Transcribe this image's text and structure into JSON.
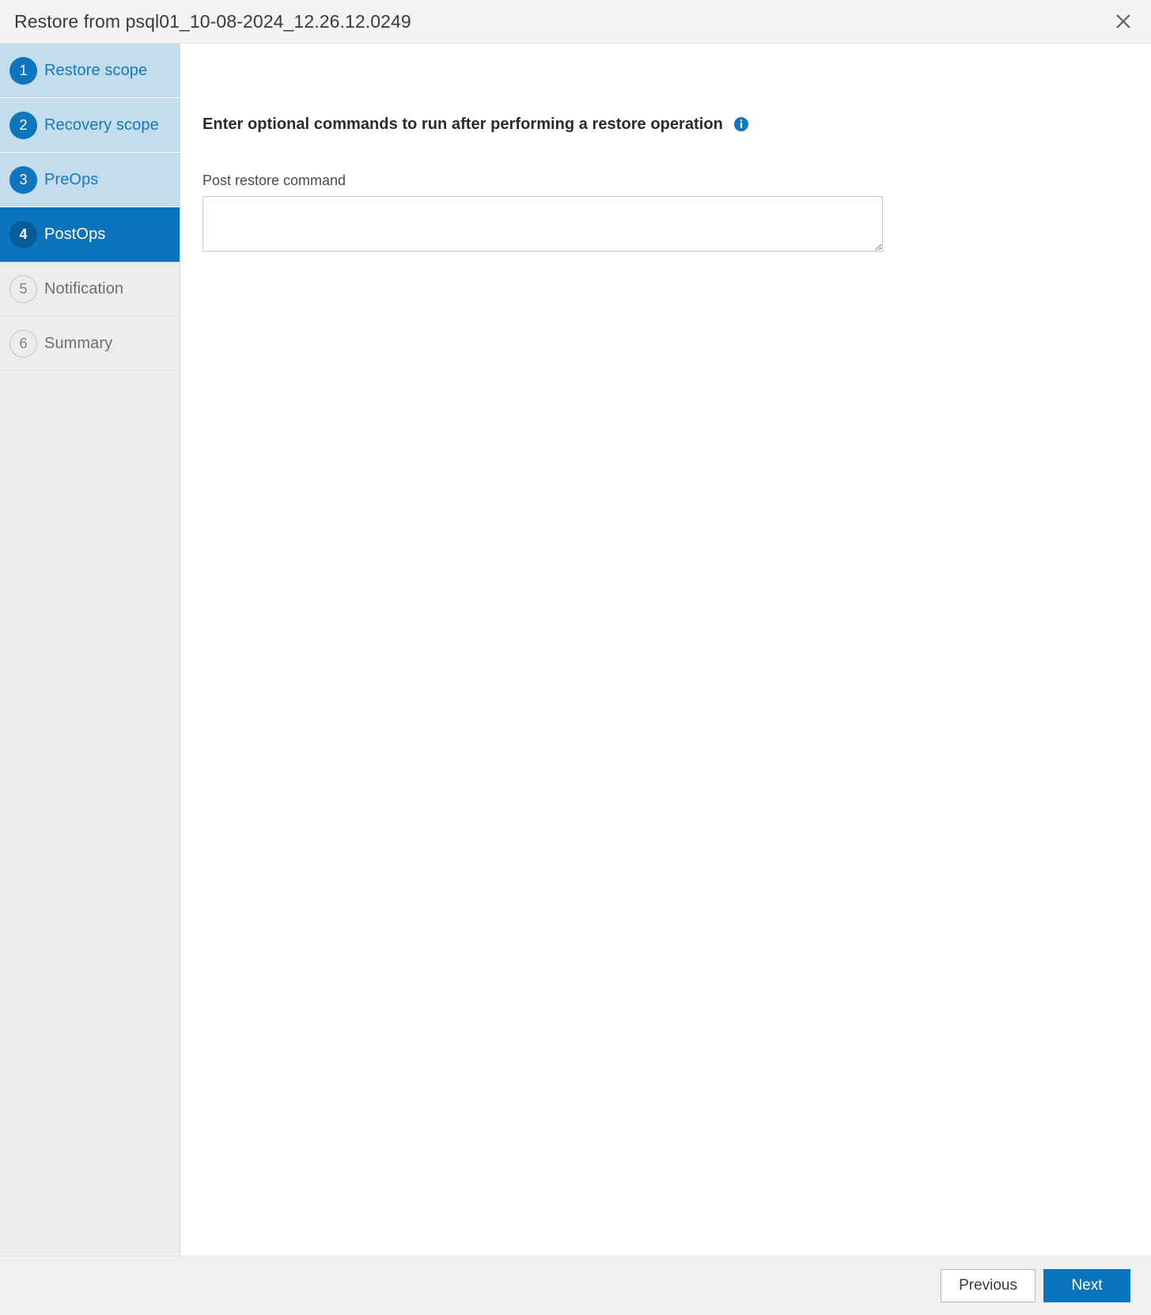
{
  "dialog": {
    "title": "Restore from psql01_10-08-2024_12.26.12.0249",
    "close_icon": "close-icon",
    "close_label": "Close"
  },
  "wizard": {
    "steps": [
      {
        "number": "1",
        "label": "Restore scope",
        "state": "done"
      },
      {
        "number": "2",
        "label": "Recovery scope",
        "state": "done"
      },
      {
        "number": "3",
        "label": "PreOps",
        "state": "done"
      },
      {
        "number": "4",
        "label": "PostOps",
        "state": "active"
      },
      {
        "number": "5",
        "label": "Notification",
        "state": "pending"
      },
      {
        "number": "6",
        "label": "Summary",
        "state": "pending"
      }
    ]
  },
  "content": {
    "heading": "Enter optional commands to run after performing a restore operation",
    "info_icon": "info-icon",
    "post_restore_command": {
      "label": "Post restore command",
      "value": "",
      "placeholder": ""
    }
  },
  "footer": {
    "previous_label": "Previous",
    "next_label": "Next"
  },
  "colors": {
    "accent": "#0a74bd",
    "step_done_bg": "#c3dcee",
    "step_done_badge": "#0f75bc",
    "step_active_badge": "#075b96",
    "sidebar_bg": "#ededed",
    "header_bg": "#f3f3f3",
    "footer_bg": "#f0f0f0"
  }
}
